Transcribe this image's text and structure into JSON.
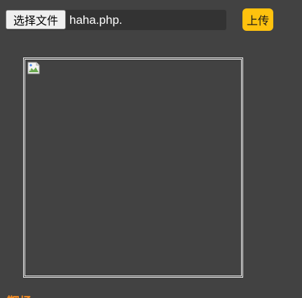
{
  "upload": {
    "choose_file_label": "选择文件",
    "selected_file_name": "haha.php.",
    "upload_button_label": "上传"
  },
  "preview": {
    "image_state": "broken-image"
  },
  "bottom_text": "靶场",
  "colors": {
    "page_background": "#424242",
    "upload_button": "#ffc20e",
    "file_field_background": "#333333",
    "preview_border": "#f2f2f2",
    "bottom_text": "#f08a24"
  }
}
